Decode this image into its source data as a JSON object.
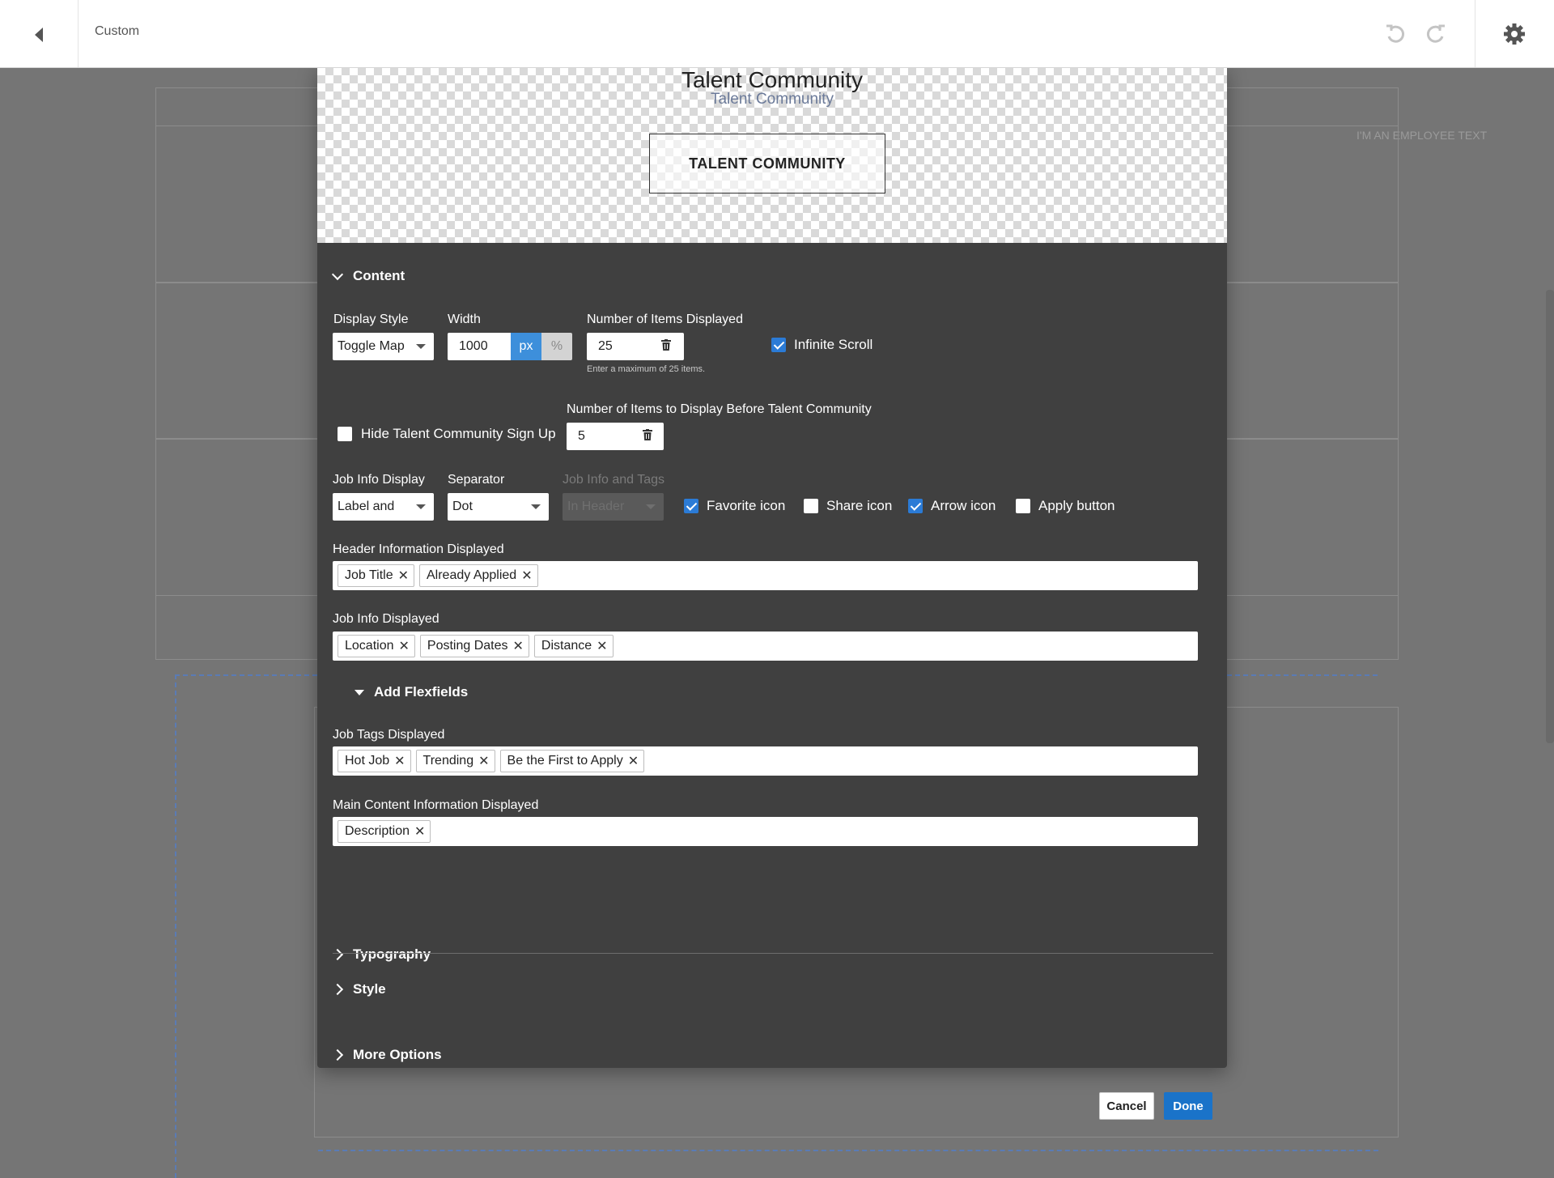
{
  "topbar": {
    "title": "Custom"
  },
  "background": {
    "header_text": "I'M AN EMPLOYEE TEXT"
  },
  "preview": {
    "title": "Talent Community",
    "subtitle": "Talent Community",
    "button_label": "TALENT COMMUNITY"
  },
  "content": {
    "section_label": "Content",
    "display_style": {
      "label": "Display Style",
      "value": "Toggle Map"
    },
    "width": {
      "label": "Width",
      "value": "1000",
      "unit_px": "px",
      "unit_pct": "%"
    },
    "items_displayed": {
      "label": "Number of Items Displayed",
      "value": "25",
      "hint": "Enter a maximum of 25 items."
    },
    "infinite_scroll": {
      "label": "Infinite Scroll",
      "checked": true
    },
    "hide_signup": {
      "label": "Hide Talent Community Sign Up",
      "checked": false
    },
    "items_before": {
      "label": "Number of Items to Display Before Talent Community",
      "value": "5"
    },
    "job_info_display": {
      "label": "Job Info Display",
      "value": "Label and"
    },
    "separator": {
      "label": "Separator",
      "value": "Dot"
    },
    "job_info_tags": {
      "label": "Job Info and Tags",
      "value": "In Header"
    },
    "favorite_icon": {
      "label": "Favorite icon",
      "checked": true
    },
    "share_icon": {
      "label": "Share icon",
      "checked": false
    },
    "arrow_icon": {
      "label": "Arrow icon",
      "checked": true
    },
    "apply_button": {
      "label": "Apply button",
      "checked": false
    },
    "header_info": {
      "label": "Header Information Displayed",
      "tags": [
        "Job Title",
        "Already Applied"
      ]
    },
    "job_info": {
      "label": "Job Info Displayed",
      "tags": [
        "Location",
        "Posting Dates",
        "Distance"
      ]
    },
    "flexfields": {
      "label": "Add Flexfields"
    },
    "job_tags": {
      "label": "Job Tags Displayed",
      "tags": [
        "Hot Job",
        "Trending",
        "Be the First to Apply"
      ]
    },
    "main_content": {
      "label": "Main Content Information Displayed",
      "tags": [
        "Description"
      ]
    }
  },
  "sections": {
    "typography": "Typography",
    "style": "Style",
    "more_options": "More Options"
  },
  "actions": {
    "cancel": "Cancel",
    "done": "Done"
  },
  "colors": {
    "primary": "#1a73c9",
    "checkbox_on": "#2b7bd6",
    "dialog_bg": "#404040"
  }
}
